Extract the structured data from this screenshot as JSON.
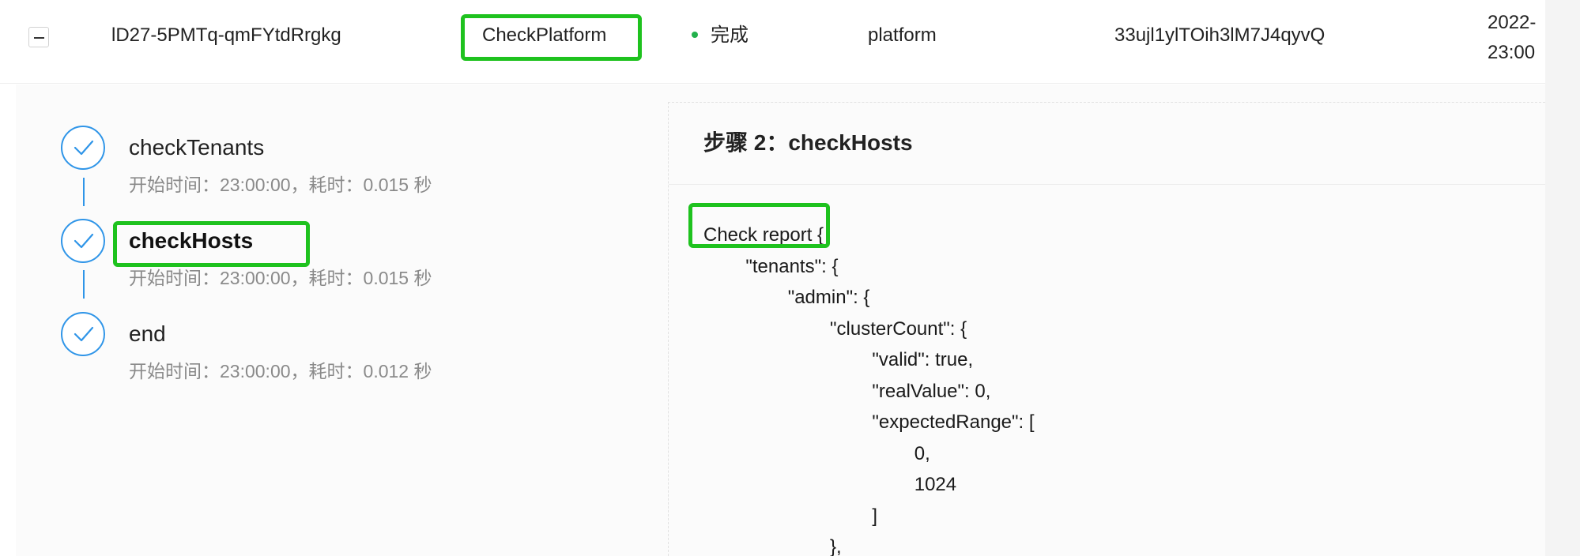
{
  "row": {
    "id": "lD27-5PMTq-qmFYtdRrgkg",
    "type": "CheckPlatform",
    "status": "完成",
    "status_color": "#22b14c",
    "kind": "platform",
    "hash": "33ujl1ylTOih3lM7J4qyvQ",
    "time_line1": "2022-",
    "time_line2": "23:00"
  },
  "steps": [
    {
      "name": "checkTenants",
      "meta": "开始时间：23:00:00，耗时：0.015 秒",
      "icon": "check-icon"
    },
    {
      "name": "checkHosts",
      "meta": "开始时间：23:00:00，耗时：0.015 秒",
      "icon": "check-icon"
    },
    {
      "name": "end",
      "meta": "开始时间：23:00:00，耗时：0.012 秒",
      "icon": "check-icon"
    }
  ],
  "detail": {
    "title": "步骤 2：checkHosts",
    "report_label": "Check report",
    "report_lines": [
      " {",
      "        \"tenants\": {",
      "                \"admin\": {",
      "                        \"clusterCount\": {",
      "                                \"valid\": true,",
      "                                \"realValue\": 0,",
      "                                \"expectedRange\": [",
      "                                        0,",
      "                                        1024",
      "                                ]",
      "                        },"
    ]
  },
  "colors": {
    "accent": "#2f95e8",
    "highlight": "#1ec21e",
    "status": "#22b14c"
  }
}
